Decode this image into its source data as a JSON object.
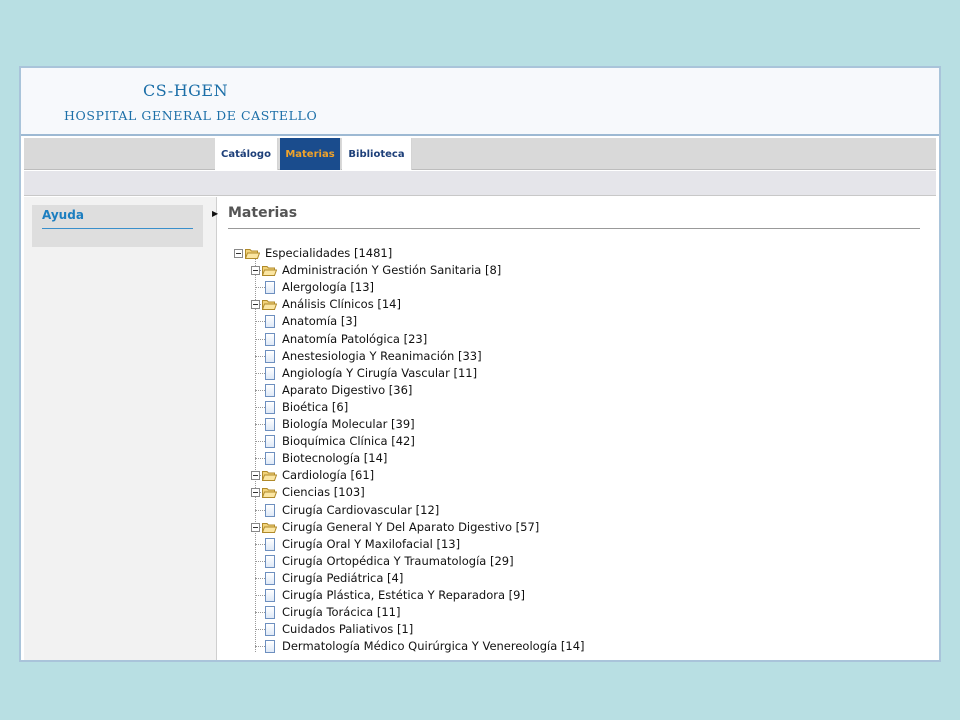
{
  "header": {
    "title": "CS-HGEN",
    "subtitle": "HOSPITAL GENERAL DE CASTELLO"
  },
  "tabs": [
    {
      "label": "Catálogo",
      "active": false
    },
    {
      "label": "Materias",
      "active": true
    },
    {
      "label": "Biblioteca",
      "active": false
    }
  ],
  "sidebar": {
    "help_label": "Ayuda"
  },
  "main": {
    "title": "Materias"
  },
  "tree": {
    "root": {
      "label": "Especialidades [1481]",
      "icon": "folder-open-icon"
    },
    "items": [
      {
        "label": "Administración Y Gestión Sanitaria [8]",
        "type": "folder"
      },
      {
        "label": "Alergología [13]",
        "type": "doc"
      },
      {
        "label": "Análisis Clínicos [14]",
        "type": "folder"
      },
      {
        "label": "Anatomía [3]",
        "type": "doc"
      },
      {
        "label": "Anatomía Patológica [23]",
        "type": "doc"
      },
      {
        "label": "Anestesiologia Y Reanimación [33]",
        "type": "doc"
      },
      {
        "label": "Angiología Y Cirugía Vascular [11]",
        "type": "doc"
      },
      {
        "label": "Aparato Digestivo [36]",
        "type": "doc"
      },
      {
        "label": "Bioética [6]",
        "type": "doc"
      },
      {
        "label": "Biología Molecular [39]",
        "type": "doc"
      },
      {
        "label": "Bioquímica Clínica [42]",
        "type": "doc"
      },
      {
        "label": "Biotecnología [14]",
        "type": "doc"
      },
      {
        "label": "Cardiología [61]",
        "type": "folder"
      },
      {
        "label": "Ciencias [103]",
        "type": "folder"
      },
      {
        "label": "Cirugía Cardiovascular [12]",
        "type": "doc"
      },
      {
        "label": "Cirugía General Y Del Aparato Digestivo [57]",
        "type": "folder"
      },
      {
        "label": "Cirugía Oral Y Maxilofacial [13]",
        "type": "doc"
      },
      {
        "label": "Cirugía Ortopédica Y Traumatología [29]",
        "type": "doc"
      },
      {
        "label": "Cirugía Pediátrica [4]",
        "type": "doc"
      },
      {
        "label": "Cirugía Plástica, Estética Y Reparadora [9]",
        "type": "doc"
      },
      {
        "label": "Cirugía Torácica [11]",
        "type": "doc"
      },
      {
        "label": "Cuidados Paliativos [1]",
        "type": "doc"
      },
      {
        "label": "Dermatología Médico Quirúrgica Y Venereología [14]",
        "type": "doc"
      }
    ]
  },
  "colors": {
    "background": "#b8dfe3",
    "brand_blue": "#1c6fa8",
    "tab_active_bg": "#1a4c8d",
    "tab_active_text": "#f1a32a"
  }
}
